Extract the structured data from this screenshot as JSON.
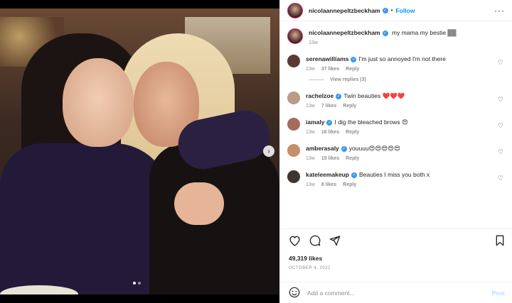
{
  "post": {
    "author": "nicolaannepeltzbeckham",
    "follow_label": "Follow",
    "more_label": "···",
    "caption": "my mama my bestie",
    "caption_emoji": "██",
    "caption_time": "13w"
  },
  "comments": [
    {
      "user": "serenawilliams",
      "text": "I'm just so annoyed I'm not there",
      "time": "13w",
      "likes": "37 likes",
      "reply": "Reply",
      "avatar_color": "#5a3b33"
    },
    {
      "user": "rachelzoe",
      "text": "Twin beauties ❤️❤️❤️",
      "time": "13w",
      "likes": "7 likes",
      "reply": "Reply",
      "avatar_color": "#b99b86"
    },
    {
      "user": "iamaly",
      "text": "I dig the bleached brows 😍",
      "time": "13w",
      "likes": "16 likes",
      "reply": "Reply",
      "avatar_color": "#a56b5c"
    },
    {
      "user": "amberasaly",
      "text": "youuuu😍😍😍😍😍",
      "time": "13w",
      "likes": "15 likes",
      "reply": "Reply",
      "avatar_color": "#c58f6a"
    },
    {
      "user": "kateleemakeup",
      "text": "Beauties I miss you both x",
      "time": "13w",
      "likes": "8 likes",
      "reply": "Reply",
      "avatar_color": "#3e3631"
    }
  ],
  "view_replies": "View replies (3)",
  "likes_count": "49,319 likes",
  "date": "OCTOBER 4, 2022",
  "add_comment_placeholder": "Add a comment...",
  "post_button": "Post",
  "accent_color": "#0095f6"
}
